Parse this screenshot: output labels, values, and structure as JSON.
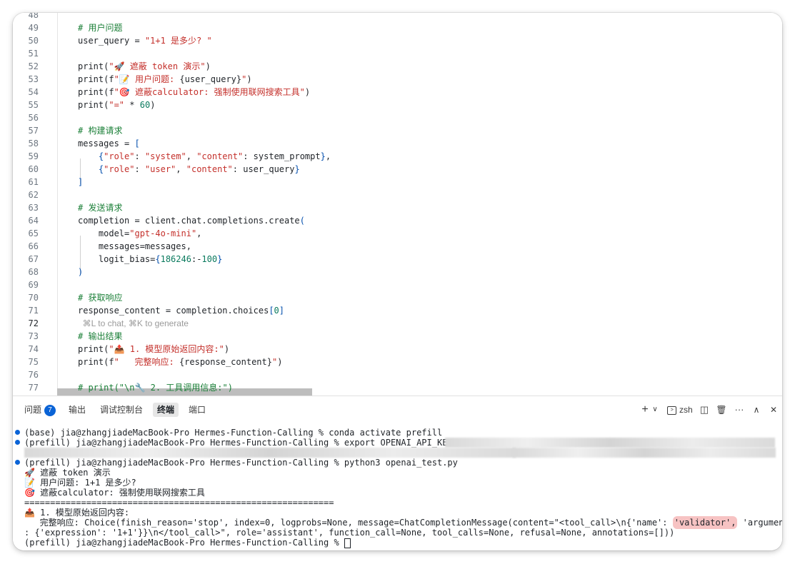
{
  "editor": {
    "lines": [
      {
        "n": "48",
        "parts": []
      },
      {
        "n": "49",
        "parts": [
          {
            "t": "    # 用户问题",
            "c": "c-com"
          }
        ]
      },
      {
        "n": "50",
        "parts": [
          {
            "t": "    user_query = ",
            "c": ""
          },
          {
            "t": "\"1+1 是多少? \"",
            "c": "c-str"
          }
        ]
      },
      {
        "n": "51",
        "parts": []
      },
      {
        "n": "52",
        "parts": [
          {
            "t": "    print(",
            "c": ""
          },
          {
            "t": "\"🚀 遮蔽 token 演示\"",
            "c": "c-str"
          },
          {
            "t": ")",
            "c": ""
          }
        ]
      },
      {
        "n": "53",
        "parts": [
          {
            "t": "    print(f",
            "c": ""
          },
          {
            "t": "\"📝 用户问题: ",
            "c": "c-str"
          },
          {
            "t": "{user_query}",
            "c": ""
          },
          {
            "t": "\"",
            "c": "c-str"
          },
          {
            "t": ")",
            "c": ""
          }
        ]
      },
      {
        "n": "54",
        "parts": [
          {
            "t": "    print(f",
            "c": ""
          },
          {
            "t": "\"🎯 遮蔽calculator: 强制使用联网搜索工具\"",
            "c": "c-str"
          },
          {
            "t": ")",
            "c": ""
          }
        ]
      },
      {
        "n": "55",
        "parts": [
          {
            "t": "    print(",
            "c": ""
          },
          {
            "t": "\"=\"",
            "c": "c-str"
          },
          {
            "t": " * ",
            "c": ""
          },
          {
            "t": "60",
            "c": "c-num"
          },
          {
            "t": ")",
            "c": ""
          }
        ]
      },
      {
        "n": "56",
        "parts": []
      },
      {
        "n": "57",
        "parts": [
          {
            "t": "    # 构建请求",
            "c": "c-com"
          }
        ]
      },
      {
        "n": "58",
        "parts": [
          {
            "t": "    messages = ",
            "c": ""
          },
          {
            "t": "[",
            "c": "c-br"
          }
        ]
      },
      {
        "n": "59",
        "parts": [
          {
            "t": "        {",
            "c": "c-br"
          },
          {
            "t": "\"role\"",
            "c": "c-str"
          },
          {
            "t": ": ",
            "c": ""
          },
          {
            "t": "\"system\"",
            "c": "c-str"
          },
          {
            "t": ", ",
            "c": ""
          },
          {
            "t": "\"content\"",
            "c": "c-str"
          },
          {
            "t": ": system_prompt",
            "c": ""
          },
          {
            "t": "}",
            "c": "c-br"
          },
          {
            "t": ",",
            "c": ""
          }
        ]
      },
      {
        "n": "60",
        "parts": [
          {
            "t": "        {",
            "c": "c-br"
          },
          {
            "t": "\"role\"",
            "c": "c-str"
          },
          {
            "t": ": ",
            "c": ""
          },
          {
            "t": "\"user\"",
            "c": "c-str"
          },
          {
            "t": ", ",
            "c": ""
          },
          {
            "t": "\"content\"",
            "c": "c-str"
          },
          {
            "t": ": user_query",
            "c": ""
          },
          {
            "t": "}",
            "c": "c-br"
          }
        ]
      },
      {
        "n": "61",
        "parts": [
          {
            "t": "    ]",
            "c": "c-br"
          }
        ]
      },
      {
        "n": "62",
        "parts": []
      },
      {
        "n": "63",
        "parts": [
          {
            "t": "    # 发送请求",
            "c": "c-com"
          }
        ]
      },
      {
        "n": "64",
        "parts": [
          {
            "t": "    completion = client.chat.completions.create",
            "c": ""
          },
          {
            "t": "(",
            "c": "c-br"
          }
        ]
      },
      {
        "n": "65",
        "parts": [
          {
            "t": "        model=",
            "c": ""
          },
          {
            "t": "\"gpt-4o-mini\"",
            "c": "c-str"
          },
          {
            "t": ",",
            "c": ""
          }
        ]
      },
      {
        "n": "66",
        "parts": [
          {
            "t": "        messages=messages,",
            "c": ""
          }
        ]
      },
      {
        "n": "67",
        "parts": [
          {
            "t": "        logit_bias=",
            "c": ""
          },
          {
            "t": "{",
            "c": "c-br"
          },
          {
            "t": "186246",
            "c": "c-num"
          },
          {
            "t": ":-",
            "c": ""
          },
          {
            "t": "100",
            "c": "c-num"
          },
          {
            "t": "}",
            "c": "c-br"
          }
        ]
      },
      {
        "n": "68",
        "parts": [
          {
            "t": "    )",
            "c": "c-br"
          }
        ]
      },
      {
        "n": "69",
        "parts": []
      },
      {
        "n": "70",
        "parts": [
          {
            "t": "    # 获取响应",
            "c": "c-com"
          }
        ]
      },
      {
        "n": "71",
        "parts": [
          {
            "t": "    response_content = completion.choices",
            "c": ""
          },
          {
            "t": "[",
            "c": "c-br"
          },
          {
            "t": "0",
            "c": "c-num"
          },
          {
            "t": "]",
            "c": "c-br"
          }
        ]
      },
      {
        "n": "72",
        "parts": [
          {
            "t": "      ⌘L to chat, ⌘K to generate",
            "c": "hint"
          }
        ],
        "current": true
      },
      {
        "n": "73",
        "parts": [
          {
            "t": "    # 输出结果",
            "c": "c-com"
          }
        ]
      },
      {
        "n": "74",
        "parts": [
          {
            "t": "    print(",
            "c": ""
          },
          {
            "t": "\"📤 1. 模型原始返回内容:\"",
            "c": "c-str"
          },
          {
            "t": ")",
            "c": ""
          }
        ]
      },
      {
        "n": "75",
        "parts": [
          {
            "t": "    print(f",
            "c": ""
          },
          {
            "t": "\"   完整响应: ",
            "c": "c-str"
          },
          {
            "t": "{response_content}",
            "c": ""
          },
          {
            "t": "\"",
            "c": "c-str"
          },
          {
            "t": ")",
            "c": ""
          }
        ]
      },
      {
        "n": "76",
        "parts": []
      },
      {
        "n": "77",
        "parts": [
          {
            "t": "    # print(\"\\n🔧 2. 工具调用信息:\")",
            "c": "c-com"
          }
        ]
      }
    ]
  },
  "panel": {
    "tabs": [
      {
        "label": "问题",
        "badge": "7"
      },
      {
        "label": "输出"
      },
      {
        "label": "调试控制台"
      },
      {
        "label": "终端",
        "active": true
      },
      {
        "label": "端口"
      }
    ],
    "tools": {
      "add": "+",
      "add_menu": "∨",
      "shell_label": "zsh",
      "split": "◫",
      "trash": "🗑",
      "more": "···",
      "maximize": "∧",
      "close": "✕"
    },
    "colors": {
      "badge": "#0a63d6",
      "highlight": "#f7c3c3"
    }
  },
  "terminal": {
    "lines": [
      {
        "dot": true,
        "text": "(base) jia@zhangjiadeMacBook-Pro Hermes-Function-Calling % conda activate prefill"
      },
      {
        "dot": true,
        "text": "(prefill) jia@zhangjiadeMacBook-Pro Hermes-Function-Calling % export OPENAI_API_KEY="
      },
      {
        "dot": false,
        "text": ""
      },
      {
        "dot": true,
        "text": "(prefill) jia@zhangjiadeMacBook-Pro Hermes-Function-Calling % python3 openai_test.py"
      },
      {
        "dot": false,
        "text": "🚀 遮蔽 token 演示"
      },
      {
        "dot": false,
        "text": "📝 用户问题: 1+1 是多少?"
      },
      {
        "dot": false,
        "text": "🎯 遮蔽calculator: 强制使用联网搜索工具"
      },
      {
        "dot": false,
        "text": "============================================================"
      },
      {
        "dot": false,
        "text": "📤 1. 模型原始返回内容:"
      },
      {
        "dot": false,
        "text": "   完整响应: Choice(finish_reason='stop', index=0, logprobs=None, message=ChatCompletionMessage(content=\"<tool_call>\\n{'name': ",
        "highlight": "'validator',",
        "after": " 'arguments'"
      },
      {
        "dot": false,
        "text": ": {'expression': '1+1'}}\\n</tool_call>\", role='assistant', function_call=None, tool_calls=None, refusal=None, annotations=[]))"
      },
      {
        "dot": false,
        "text": "(prefill) jia@zhangjiadeMacBook-Pro Hermes-Function-Calling % ",
        "cursor": true
      }
    ]
  }
}
